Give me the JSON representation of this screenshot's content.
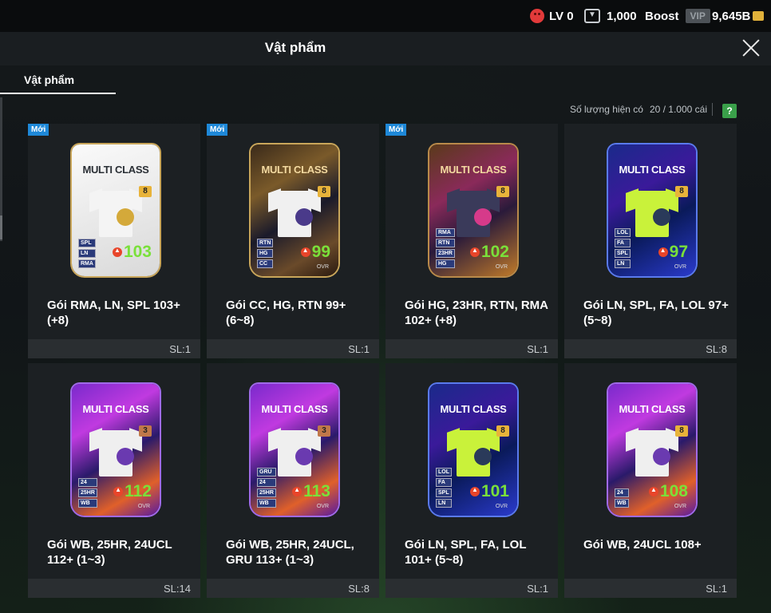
{
  "status": {
    "level": "LV 0",
    "coins": "1,000",
    "boost_label": "Boost",
    "vip_label": "VIP",
    "bp": "9,645B"
  },
  "header": {
    "title": "Vật phẩm"
  },
  "tabs": [
    {
      "label": "Vật phẩm",
      "active": true
    }
  ],
  "inventory": {
    "count_label": "Số lượng hiện có",
    "count_value": "20 / 1.000 cái",
    "help": "?"
  },
  "cards": [
    {
      "badge": "Mới",
      "card_title": "MULTI CLASS",
      "level": "8",
      "tags": [
        "SPL",
        "LN",
        "RMA"
      ],
      "ovr": "103",
      "ovr_label": "OVR",
      "name": "Gói RMA, LN, SPL 103+ (+8)",
      "qty": "SL:1",
      "style": "white"
    },
    {
      "badge": "Mới",
      "card_title": "MULTI CLASS",
      "level": "8",
      "tags": [
        "RTN",
        "HG",
        "CC"
      ],
      "ovr": "99",
      "ovr_label": "OVR",
      "name": "Gói CC, HG, RTN 99+ (6~8)",
      "qty": "SL:1",
      "style": "cc"
    },
    {
      "badge": "Mới",
      "card_title": "MULTI CLASS",
      "level": "8",
      "tags": [
        "RMA",
        "RTN",
        "23HR",
        "HG"
      ],
      "ovr": "102",
      "ovr_label": "OVR",
      "name": "Gói HG, 23HR, RTN, RMA 102+ (+8)",
      "qty": "SL:1",
      "style": "hg"
    },
    {
      "badge": "",
      "card_title": "MULTI CLASS",
      "level": "8",
      "tags": [
        "LOL",
        "FA",
        "SPL",
        "LN"
      ],
      "ovr": "97",
      "ovr_label": "OVR",
      "name": "Gói LN, SPL, FA, LOL 97+ (5~8)",
      "qty": "SL:8",
      "style": "lol"
    },
    {
      "badge": "",
      "card_title": "MULTI CLASS",
      "level": "3",
      "tags": [
        "24",
        "25HR",
        "WB"
      ],
      "ovr": "112",
      "ovr_label": "OVR",
      "name": "Gói WB, 25HR, 24UCL 112+ (1~3)",
      "qty": "SL:14",
      "style": "wb"
    },
    {
      "badge": "",
      "card_title": "MULTI CLASS",
      "level": "3",
      "tags": [
        "GRU",
        "24",
        "25HR",
        "WB"
      ],
      "ovr": "113",
      "ovr_label": "OVR",
      "name": "Gói WB, 25HR, 24UCL, GRU 113+ (1~3)",
      "qty": "SL:8",
      "style": "wb"
    },
    {
      "badge": "",
      "card_title": "MULTI CLASS",
      "level": "8",
      "tags": [
        "LOL",
        "FA",
        "SPL",
        "LN"
      ],
      "ovr": "101",
      "ovr_label": "OVR",
      "name": "Gói LN, SPL, FA, LOL 101+ (5~8)",
      "qty": "SL:1",
      "style": "lol"
    },
    {
      "badge": "",
      "card_title": "MULTI CLASS",
      "level": "8",
      "tags": [
        "24",
        "WB"
      ],
      "ovr": "108",
      "ovr_label": "OVR",
      "name": "Gói WB, 24UCL 108+",
      "qty": "SL:1",
      "style": "wb"
    }
  ],
  "colors": {
    "new_badge": "#1e88d8",
    "ovr_green": "#7ae03a",
    "help_green": "#3aa04a"
  }
}
